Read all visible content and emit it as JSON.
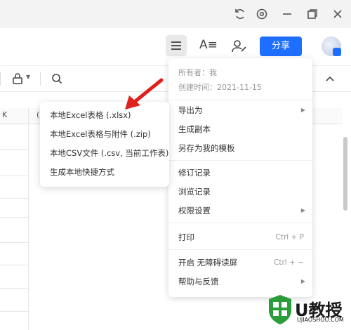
{
  "toolbar": {
    "share_label": "分享",
    "font_icon": "A≡"
  },
  "grid": {
    "column_k": "K",
    "column_l": "("
  },
  "main_menu": {
    "owner": "所有者：我",
    "created": "创建时间：2021-11-15",
    "items": [
      {
        "label": "导出为",
        "submenu": true
      },
      {
        "label": "生成副本"
      },
      {
        "label": "另存为我的模板"
      },
      {
        "label": "修订记录"
      },
      {
        "label": "浏览记录"
      },
      {
        "label": "权限设置",
        "submenu": true
      },
      {
        "label": "打印",
        "shortcut": "Ctrl + P"
      },
      {
        "label": "开启 无障碍读屏",
        "shortcut": "Ctrl + ~"
      },
      {
        "label": "帮助与反馈",
        "submenu": true
      }
    ]
  },
  "export_menu": {
    "items": [
      {
        "label": "本地Excel表格 (.xlsx)"
      },
      {
        "label": "本地Excel表格与附件 (.zip)"
      },
      {
        "label": "本地CSV文件 (.csv, 当前工作表)"
      },
      {
        "label": "生成本地快捷方式"
      }
    ]
  },
  "watermark": {
    "text": "U教授",
    "sub": "UJIAOSHOU.COM"
  },
  "colors": {
    "accent": "#1e6fff",
    "arrow": "#e0201c"
  }
}
